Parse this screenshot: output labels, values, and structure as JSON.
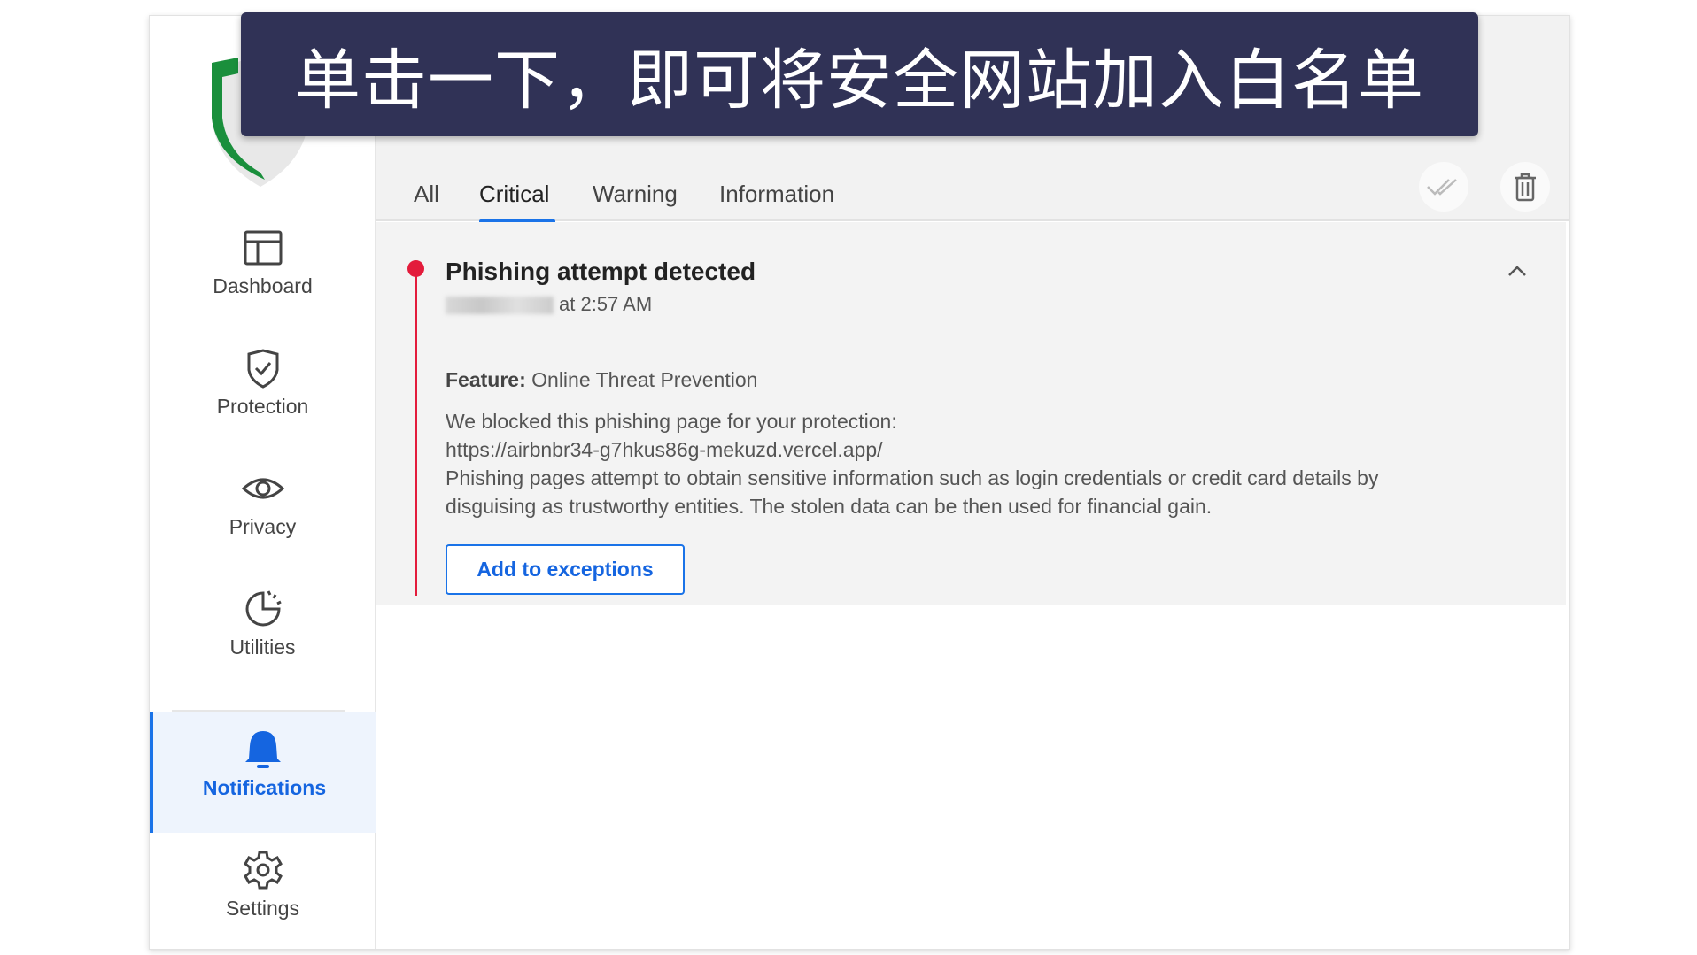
{
  "banner": {
    "text": "单击一下，即可将安全网站加入白名单"
  },
  "sidebar": {
    "items": [
      {
        "label": "Dashboard",
        "icon": "dashboard-icon"
      },
      {
        "label": "Protection",
        "icon": "shield-check-icon"
      },
      {
        "label": "Privacy",
        "icon": "eye-icon"
      },
      {
        "label": "Utilities",
        "icon": "utilities-icon"
      },
      {
        "label": "Notifications",
        "icon": "bell-icon",
        "active": true
      },
      {
        "label": "Settings",
        "icon": "gear-icon"
      }
    ]
  },
  "tabs": [
    {
      "label": "All"
    },
    {
      "label": "Critical",
      "active": true
    },
    {
      "label": "Warning"
    },
    {
      "label": "Information"
    }
  ],
  "notification": {
    "title": "Phishing attempt detected",
    "time": "at 2:57 AM",
    "feature_label": "Feature:",
    "feature_value": "Online Threat Prevention",
    "line1": "We blocked this phishing page for your protection:",
    "url": "https://airbnbr34-g7hkus86g-mekuzd.vercel.app/",
    "line3": "Phishing pages attempt to obtain sensitive information such as login credentials or credit card details by",
    "line4": "disguising as trustworthy entities. The stolen data can be then used for financial gain.",
    "button": "Add to exceptions",
    "severity_color": "#e31b3b"
  },
  "colors": {
    "accent": "#1a73e8",
    "banner": "#303256",
    "logo": "#1a8f3c"
  }
}
